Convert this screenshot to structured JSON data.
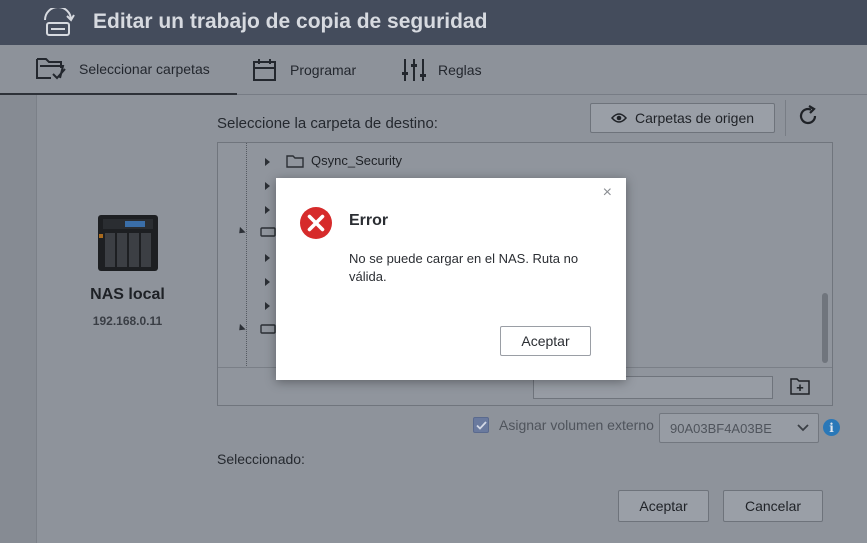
{
  "window": {
    "title": "Editar un trabajo de copia de seguridad"
  },
  "tabs": [
    {
      "label": "Seleccionar carpetas",
      "icon": "folder-check-icon"
    },
    {
      "label": "Programar",
      "icon": "calendar-icon"
    },
    {
      "label": "Reglas",
      "icon": "sliders-icon"
    }
  ],
  "nas": {
    "name": "NAS local",
    "ip": "192.168.0.11"
  },
  "destination": {
    "label": "Seleccione la carpeta de destino:",
    "source_button": "Carpetas de origen",
    "tree_visible_folder": "Qsync_Security",
    "path_value": ""
  },
  "assign": {
    "label": "Asignar volumen externo",
    "checked": true,
    "volume": "90A03BF4A03BE"
  },
  "selected_label": "Seleccionado:",
  "footer": {
    "accept": "Aceptar",
    "cancel": "Cancelar"
  },
  "dialog": {
    "title": "Error",
    "message": "No se puede cargar en el NAS. Ruta no válida.",
    "ok": "Aceptar",
    "close": "×"
  },
  "colors": {
    "error_red": "#d62b2b",
    "info_blue": "#2a78b8"
  }
}
